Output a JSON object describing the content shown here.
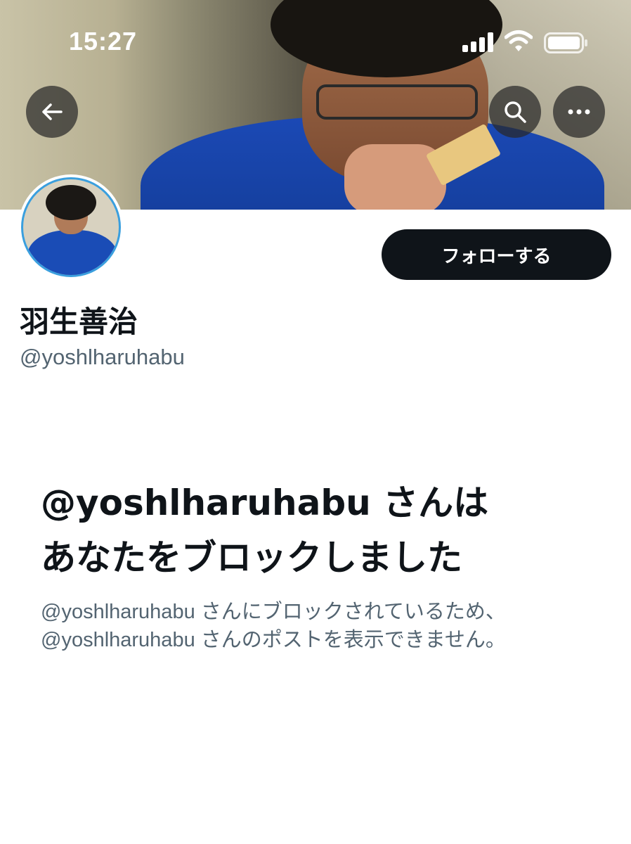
{
  "status_bar": {
    "time": "15:27"
  },
  "header": {
    "back_icon": "arrow-left-icon",
    "search_icon": "search-icon",
    "more_icon": "more-horizontal-icon"
  },
  "profile": {
    "display_name": "羽生善治",
    "handle": "@yoshlharuhabu",
    "follow_label": "フォローする"
  },
  "blocked_notice": {
    "title_line1": "@yoshlharuhabu さんは",
    "title_line2": "あなたをブロックしました",
    "description_line1": "@yoshlharuhabu さんにブロックされているため、",
    "description_line2": "@yoshlharuhabu さんのポストを表示できません。"
  },
  "colors": {
    "primary_text": "#0f1419",
    "secondary_text": "#536471",
    "follow_button_bg": "#0f1419",
    "avatar_ring": "#3a9fde"
  }
}
